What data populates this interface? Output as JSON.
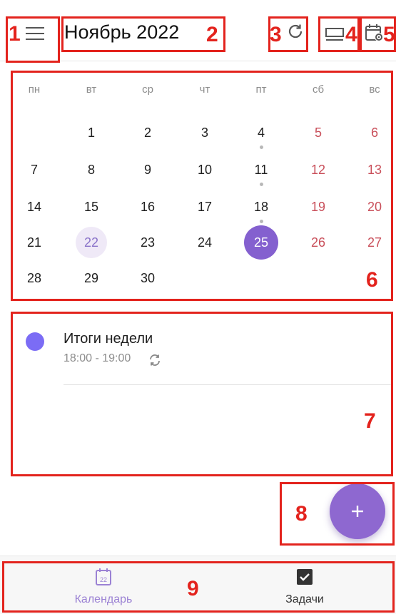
{
  "header": {
    "title": "Ноябрь 2022",
    "menu_icon": "hamburger-menu-icon",
    "refresh_icon": "refresh-icon",
    "view_icon": "view-mode-icon",
    "settings_icon": "calendar-settings-icon"
  },
  "calendar": {
    "weekdays": [
      "пн",
      "вт",
      "ср",
      "чт",
      "пт",
      "сб",
      "вс"
    ],
    "weeks": [
      [
        "",
        "1",
        "2",
        "3",
        "4",
        "5",
        "6"
      ],
      [
        "7",
        "8",
        "9",
        "10",
        "11",
        "12",
        "13"
      ],
      [
        "14",
        "15",
        "16",
        "17",
        "18",
        "19",
        "20"
      ],
      [
        "21",
        "22",
        "23",
        "24",
        "25",
        "26",
        "27"
      ],
      [
        "28",
        "29",
        "30",
        "",
        "",
        "",
        ""
      ]
    ],
    "today": "22",
    "selected": "25",
    "days_with_events": [
      "4",
      "11",
      "18"
    ],
    "colors": {
      "weekend": "#c94f5a",
      "selected_bg": "#8460cf",
      "today_bg": "#efe9f7",
      "today_text": "#8a72c9"
    }
  },
  "events": [
    {
      "title": "Итоги недели",
      "time": "18:00 - 19:00",
      "color": "#7b6cf5",
      "icon": "repeat-icon"
    }
  ],
  "fab": {
    "icon": "plus-icon",
    "color": "#8e68d0"
  },
  "bottom_nav": {
    "items": [
      {
        "label": "Календарь",
        "icon": "calendar-icon",
        "icon_text": "22",
        "active": true,
        "color": "#9b82d4"
      },
      {
        "label": "Задачи",
        "icon": "checkbox-icon",
        "active": false,
        "color": "#333333"
      }
    ]
  },
  "annotations": [
    "1",
    "2",
    "3",
    "4",
    "5",
    "6",
    "7",
    "8",
    "9"
  ]
}
